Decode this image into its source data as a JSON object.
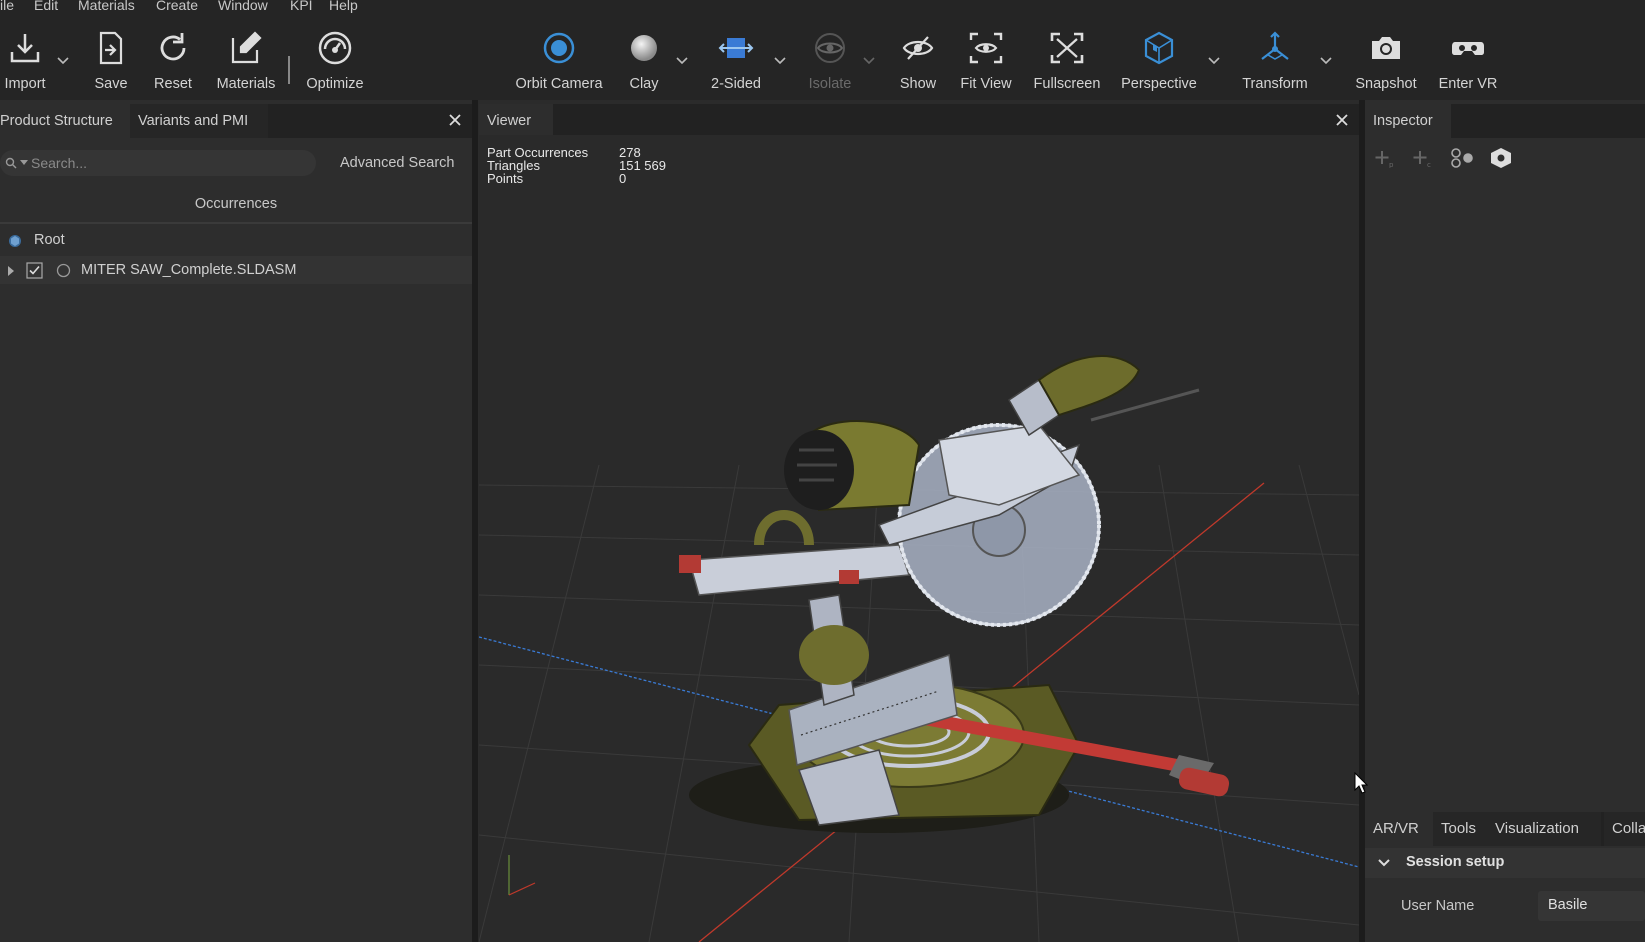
{
  "menu": [
    "ile",
    "Edit",
    "Materials",
    "Create",
    "Window",
    "KPI",
    "Help"
  ],
  "toolbar": {
    "import": "Import",
    "save": "Save",
    "reset": "Reset",
    "materials": "Materials",
    "optimize": "Optimize",
    "orbit_camera": "Orbit Camera",
    "clay": "Clay",
    "two_sided": "2-Sided",
    "isolate": "Isolate",
    "show": "Show",
    "fit_view": "Fit View",
    "fullscreen": "Fullscreen",
    "perspective": "Perspective",
    "transform": "Transform",
    "snapshot": "Snapshot",
    "enter_vr": "Enter VR"
  },
  "left_panel": {
    "tabs": [
      "Product Structure",
      "Variants and PMI"
    ],
    "search_placeholder": "Search...",
    "advanced_search": "Advanced Search",
    "section_title": "Occurrences",
    "tree": [
      {
        "label": "Root"
      },
      {
        "label": "MITER SAW_Complete.SLDASM",
        "checked": true
      }
    ]
  },
  "viewer": {
    "tab": "Viewer",
    "stats": [
      {
        "key": "Part Occurrences",
        "value": "278"
      },
      {
        "key": "Triangles",
        "value": "151 569"
      },
      {
        "key": "Points",
        "value": "0"
      }
    ]
  },
  "inspector": {
    "tab": "Inspector",
    "bottom_tabs": [
      "AR/VR",
      "Tools",
      "Visualization",
      "Colla"
    ],
    "section": "Session setup",
    "user_name_label": "User Name",
    "user_name_value": "Basile"
  },
  "colors": {
    "accent": "#3a8fd6",
    "background": "#2b2b2b",
    "toolbar": "#252525",
    "saw_olive": "#6b6a2a",
    "axis_red": "#c0392b",
    "axis_blue": "#3a7bd5"
  }
}
